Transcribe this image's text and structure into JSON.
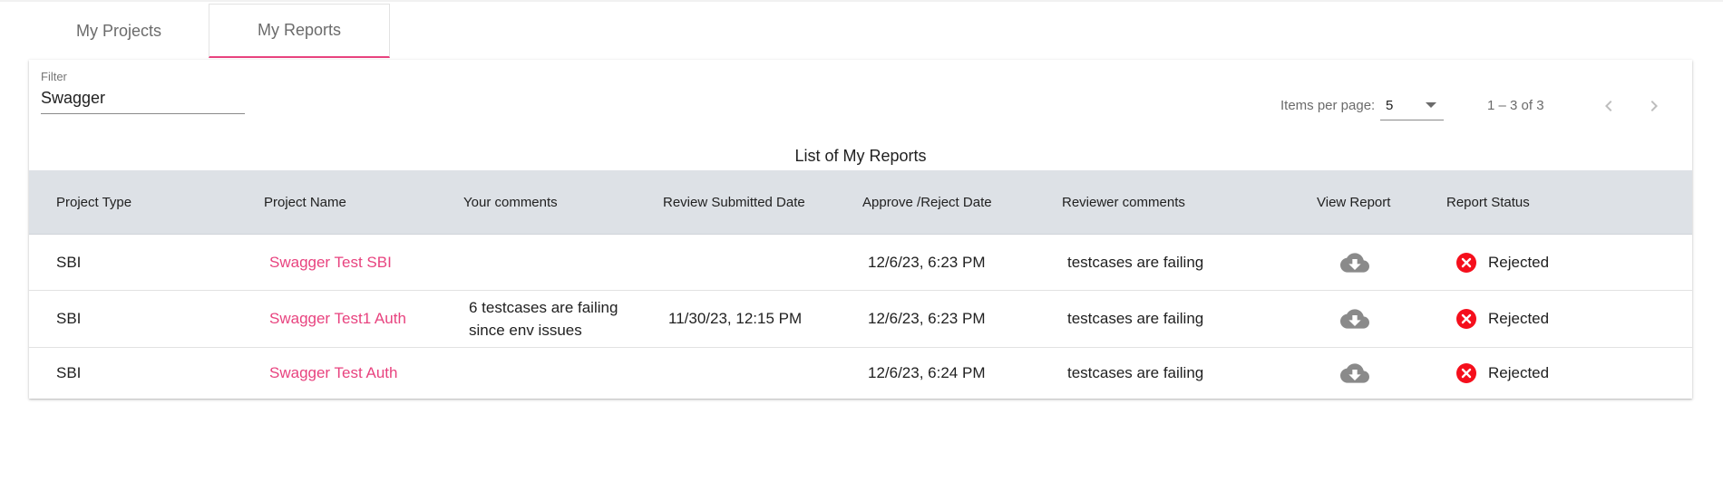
{
  "tabs": [
    {
      "label": "My Projects"
    },
    {
      "label": "My Reports"
    }
  ],
  "filter": {
    "label": "Filter",
    "value": "Swagger"
  },
  "paginator": {
    "items_per_page_label": "Items per page:",
    "items_per_page_value": "5",
    "range_label": "1 – 3 of 3"
  },
  "table": {
    "title": "List of My Reports",
    "columns": [
      "Project Type",
      "Project Name",
      "Your comments",
      "Review Submitted Date",
      "Approve /Reject Date",
      "Reviewer comments",
      "View Report",
      "Report Status"
    ],
    "rows": [
      {
        "type": "SBI",
        "name": "Swagger Test SBI",
        "comments": "",
        "submitted": "",
        "approve_date": "12/6/23, 6:23 PM",
        "reviewer_comments": "testcases are failing",
        "status": "Rejected"
      },
      {
        "type": "SBI",
        "name": "Swagger Test1 Auth",
        "comments": "6 testcases are failing since env issues",
        "submitted": "11/30/23, 12:15 PM",
        "approve_date": "12/6/23, 6:23 PM",
        "reviewer_comments": "testcases are failing",
        "status": "Rejected"
      },
      {
        "type": "SBI",
        "name": "Swagger Test Auth",
        "comments": "",
        "submitted": "",
        "approve_date": "12/6/23, 6:24 PM",
        "reviewer_comments": "testcases are failing",
        "status": "Rejected"
      }
    ]
  },
  "icons": {
    "view_report": "cloud-download-icon",
    "status_rejected": "cancel-circle-icon",
    "prev_page": "chevron-left-icon",
    "next_page": "chevron-right-icon"
  },
  "colors": {
    "accent": "#e8437f",
    "rejected": "#f50f1c",
    "header_bg": "#dde1e6",
    "download_icon": "#8a8a8a"
  }
}
